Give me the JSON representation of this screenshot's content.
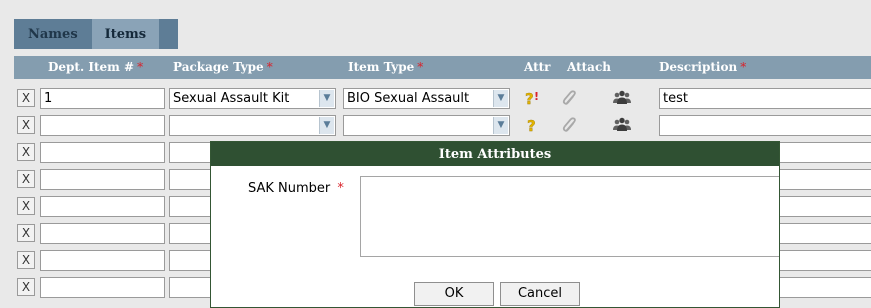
{
  "tabs": [
    {
      "label": "Names",
      "active": false
    },
    {
      "label": "Items",
      "active": true
    }
  ],
  "columns": {
    "dept_item": "Dept. Item #",
    "package_type": "Package Type",
    "item_type": "Item Type",
    "attr": "Attr",
    "attach": "Attach",
    "description": "Description",
    "required_marker": "*"
  },
  "rows": [
    {
      "remove": "X",
      "dept_item": "1",
      "package_type": "Sexual Assault Kit",
      "item_type": "BIO Sexual Assault",
      "description": "test"
    },
    {
      "remove": "X",
      "dept_item": "",
      "package_type": "",
      "item_type": "",
      "description": ""
    },
    {
      "remove": "X",
      "dept_item": "",
      "package_type": "",
      "item_type": "",
      "description": ""
    },
    {
      "remove": "X",
      "dept_item": "",
      "package_type": "",
      "item_type": "",
      "description": ""
    },
    {
      "remove": "X",
      "dept_item": "",
      "package_type": "",
      "item_type": "",
      "description": ""
    },
    {
      "remove": "X",
      "dept_item": "",
      "package_type": "",
      "item_type": "",
      "description": ""
    },
    {
      "remove": "X",
      "dept_item": "",
      "package_type": "",
      "item_type": "",
      "description": ""
    },
    {
      "remove": "X",
      "dept_item": "",
      "package_type": "",
      "item_type": "",
      "description": ""
    }
  ],
  "icons": {
    "attr": "question-mark-icon",
    "attr_alert": "question-exclamation-icon",
    "attach": "paperclip-icon",
    "people": "people-icon"
  },
  "modal": {
    "title": "Item Attributes",
    "field_label": "SAK Number",
    "required_marker": "*",
    "field_value": "",
    "ok_label": "OK",
    "cancel_label": "Cancel"
  },
  "colors": {
    "header": "#849daf",
    "tab_active": "#8aa3b7",
    "modal_header": "#2f5032",
    "required": "#d9222a"
  }
}
